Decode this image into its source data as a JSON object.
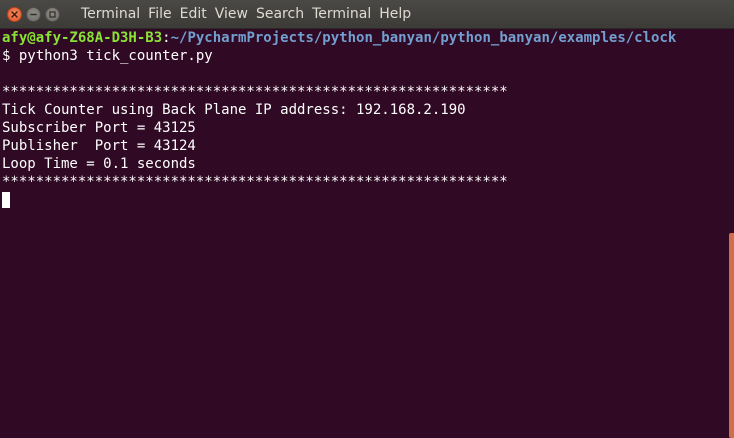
{
  "window": {
    "buttons": {
      "close_icon": "close-icon",
      "minimize_icon": "minimize-icon",
      "maximize_icon": "maximize-icon"
    }
  },
  "menu": {
    "items": [
      "Terminal",
      "File",
      "Edit",
      "View",
      "Search",
      "Terminal",
      "Help"
    ]
  },
  "terminal": {
    "prompt": {
      "user_host": "afy@afy-Z68A-D3H-B3",
      "separator": ":",
      "path": "~/PycharmProjects/python_banyan/python_banyan/examples/clock"
    },
    "command_line": "$ python3 tick_counter.py",
    "output": [
      "",
      "************************************************************",
      "Tick Counter using Back Plane IP address: 192.168.2.190",
      "Subscriber Port = 43125",
      "Publisher  Port = 43124",
      "Loop Time = 0.1 seconds",
      "************************************************************"
    ]
  },
  "colors": {
    "background": "#300a24",
    "prompt_user": "#8ae234",
    "prompt_path": "#729fcf",
    "close_button": "#e0572a",
    "scrollbar": "#cf6e4b"
  }
}
